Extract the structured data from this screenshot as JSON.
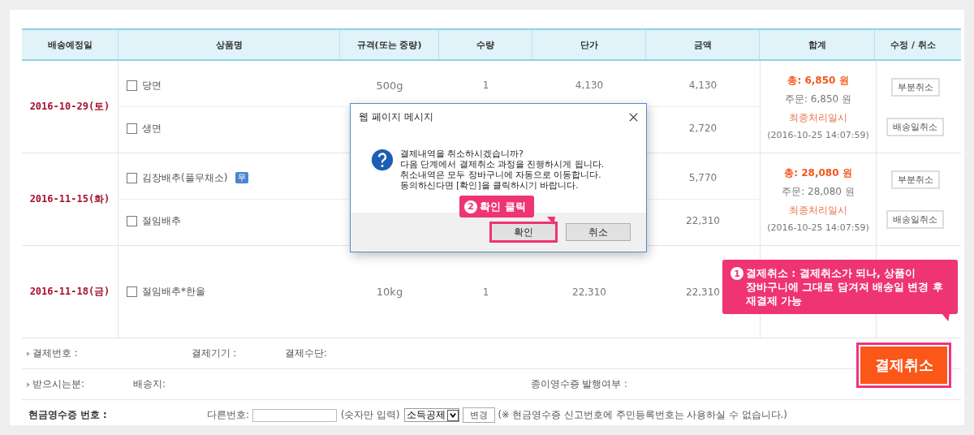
{
  "table": {
    "columns": [
      "배송예정일",
      "상품명",
      "규격(또는 중량)",
      "수량",
      "단가",
      "금액",
      "합계",
      "수정 / 취소"
    ],
    "groups": [
      {
        "delivery_date": "2016-10-29(토)",
        "items": [
          {
            "name": "당면",
            "checked": false,
            "spec": "500g",
            "quantity": "1",
            "unit_price": "4,130",
            "amount": "4,130"
          },
          {
            "name": "생면",
            "checked": false,
            "amount": "2,720"
          }
        ],
        "total": "총: 6,850 원",
        "order": "주문: 6,850 원",
        "processed_label": "최종처리일시",
        "processed_at": "(2016-10-25 14:07:59)",
        "actions": [
          "부분취소",
          "배송일취소"
        ]
      },
      {
        "delivery_date": "2016-11-15(화)",
        "items": [
          {
            "name": "김장배추(풀무채소)",
            "checked": false,
            "badge": "무",
            "amount": "5,770"
          },
          {
            "name": "절임배추",
            "checked": false,
            "amount": "22,310"
          }
        ],
        "total": "총: 28,080 원",
        "order": "주문: 28,080 원",
        "processed_label": "최종처리일시",
        "processed_at": "(2016-10-25 14:07:59)",
        "actions": [
          "부분취소",
          "배송일취소"
        ]
      },
      {
        "delivery_date": "2016-11-18(금)",
        "items": [
          {
            "name": "절임배추*한울",
            "checked": false,
            "spec": "10kg",
            "quantity": "1",
            "unit_price": "22,310",
            "amount": "22,310"
          }
        ]
      }
    ]
  },
  "info_rows": [
    [
      "결제번호 :",
      "결제기기 :",
      "결제수단:"
    ],
    [
      "받으시는분:",
      "배송지:",
      "종이영수증 발행여부 :"
    ]
  ],
  "cash_receipt": {
    "label": "현금영수증 번호 :",
    "other_label": "다른번호:",
    "hint": "(숫자만 입력)",
    "select_value": "소득공제",
    "button": "변경",
    "note": "(※ 현금영수증 신고번호에 주민등록번호는 사용하실 수 없습니다.)"
  },
  "cancel_button": "결제취소",
  "dialog": {
    "title": "웹 페이지 메시지",
    "lines": [
      "결제내역을 취소하시겠습니까?",
      "다음 단계에서 결제취소 과정을 진행하시게 됩니다.",
      "취소내역은 모두 장바구니에 자동으로 이동합니다.",
      "동의하신다면 [확인]을 클릭하시기 바랍니다."
    ],
    "buttons": [
      {
        "label": "확인",
        "highlighted": true
      },
      {
        "label": "취소",
        "highlighted": false
      }
    ]
  },
  "callouts": [
    {
      "number": "2",
      "text": "확인 클릭"
    },
    {
      "number": "1",
      "text": "결제취소 : 결제취소가 되나, 상품이 장바구니에 그대로 담겨져 배송일 변경 후 재결제 가능"
    }
  ]
}
